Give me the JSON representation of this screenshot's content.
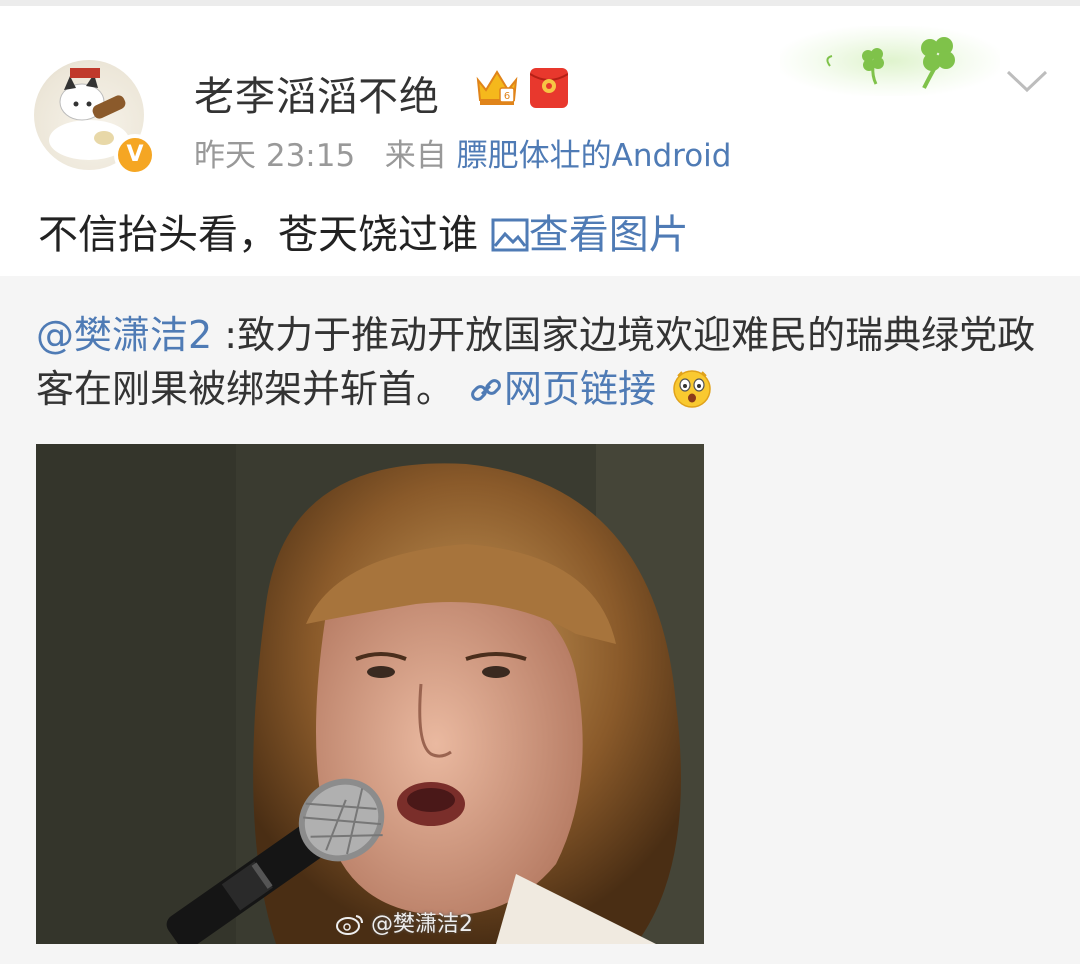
{
  "post": {
    "username": "老李滔滔不绝",
    "verified_mark": "V",
    "time": "昨天 23:15",
    "source_prefix": "来自",
    "source": "膘肥体壮的Android",
    "text": "不信抬头看，苍天饶过谁 ",
    "view_image_label": "查看图片"
  },
  "repost": {
    "mention": "@樊潇洁2",
    "text": " :致力于推动开放国家边境欢迎难民的瑞典绿党政客在刚果被绑架并斩首。",
    "link_label": "网页链接",
    "image_watermark": "@樊潇洁2"
  },
  "icons": {
    "more": "chevron-down-icon",
    "picture": "picture-icon",
    "link": "link-icon",
    "emoji": "surprised-emoji-icon",
    "member_badge": "crown-badge-icon",
    "red_packet": "red-packet-icon"
  },
  "colors": {
    "link": "#4f7bb5",
    "repost_bg": "#f5f5f5",
    "verified": "#f5a623"
  }
}
